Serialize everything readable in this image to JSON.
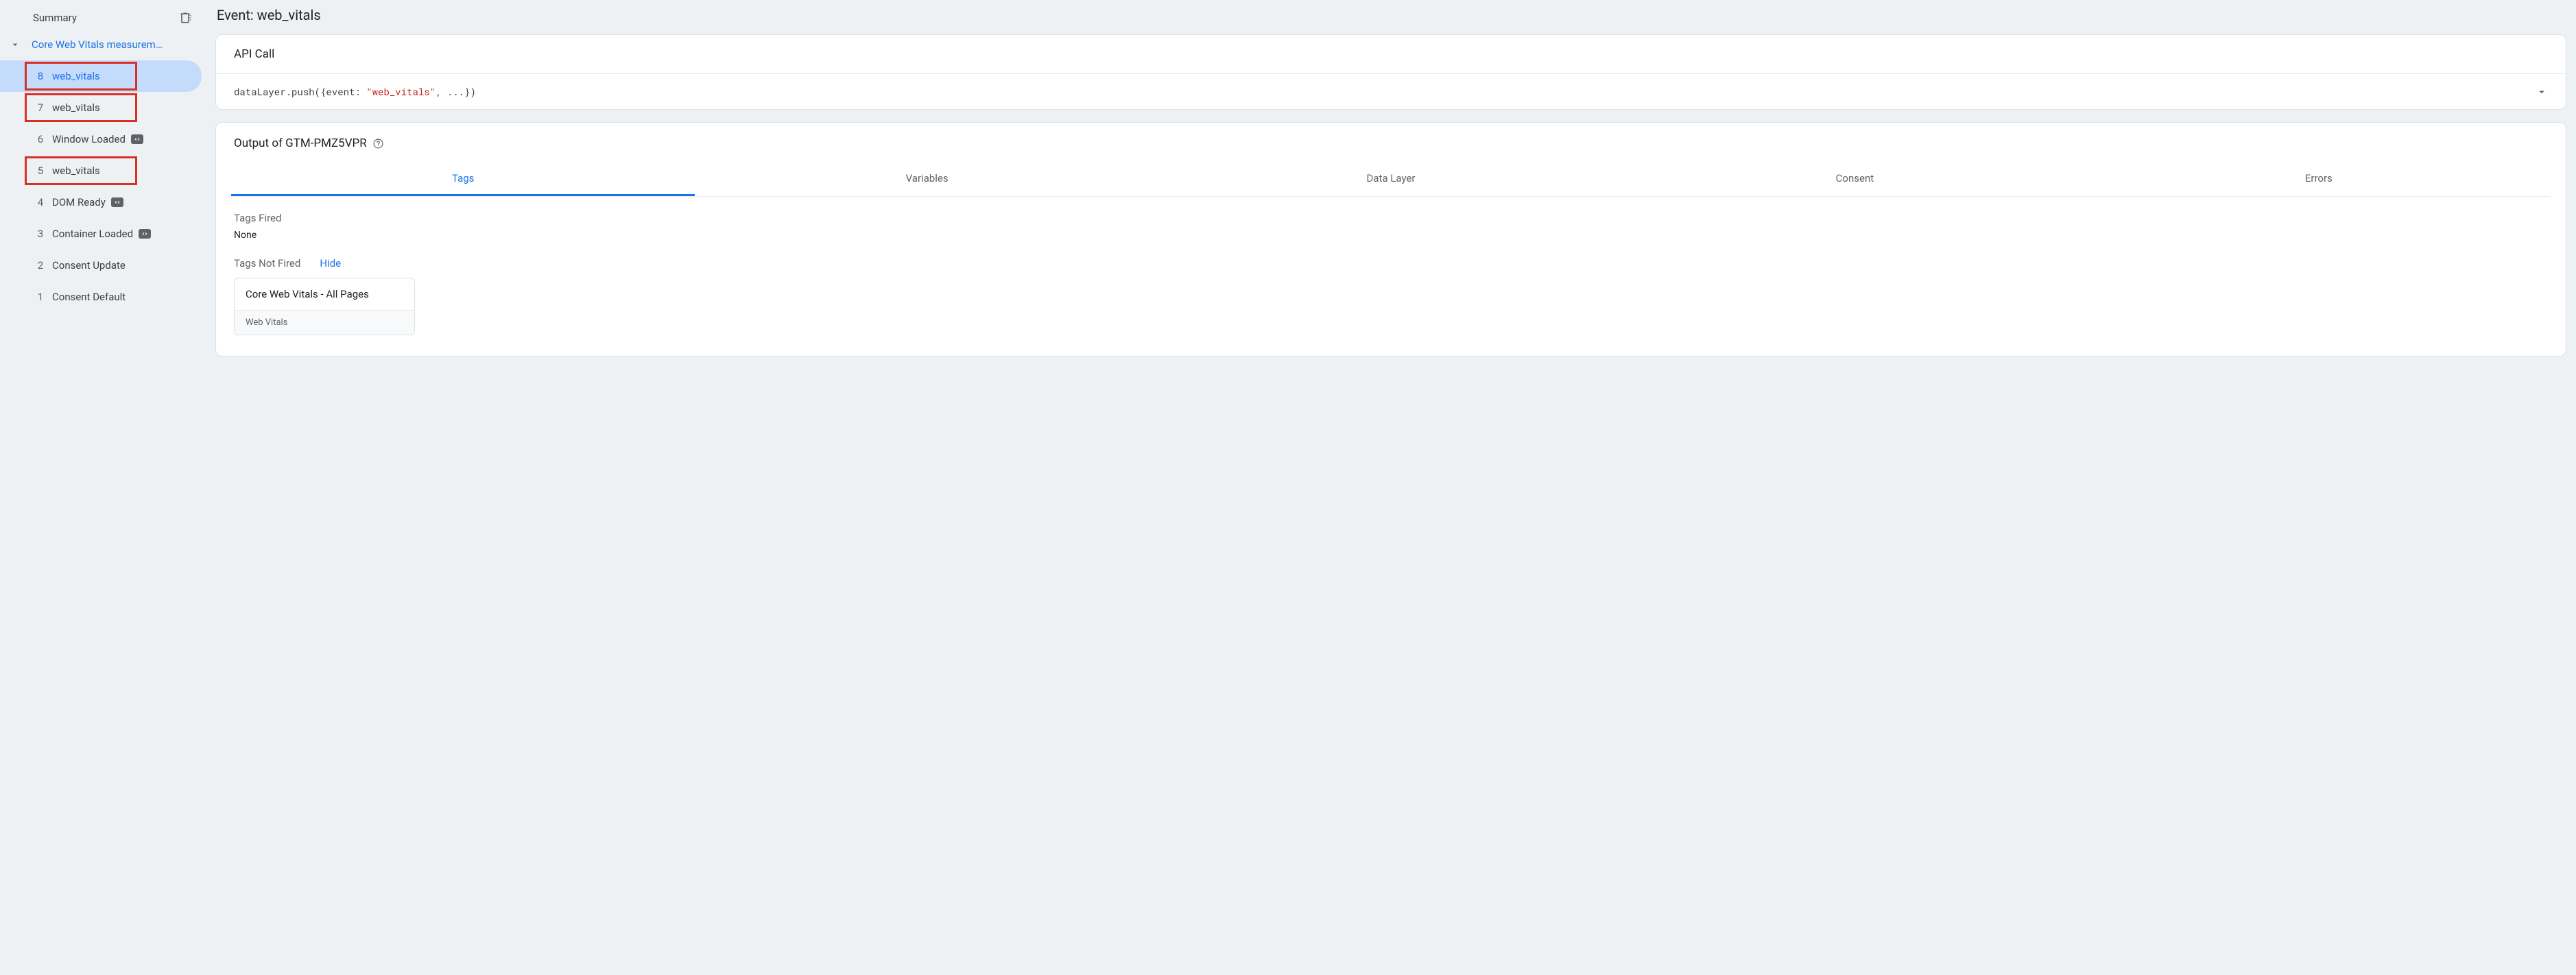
{
  "sidebar": {
    "summary_label": "Summary",
    "group_label": "Core Web Vitals measurem…",
    "events": [
      {
        "num": "8",
        "label": "web_vitals",
        "selected": true,
        "highlighted": true,
        "code": false
      },
      {
        "num": "7",
        "label": "web_vitals",
        "selected": false,
        "highlighted": true,
        "code": false
      },
      {
        "num": "6",
        "label": "Window Loaded",
        "selected": false,
        "highlighted": false,
        "code": true
      },
      {
        "num": "5",
        "label": "web_vitals",
        "selected": false,
        "highlighted": true,
        "code": false
      },
      {
        "num": "4",
        "label": "DOM Ready",
        "selected": false,
        "highlighted": false,
        "code": true
      },
      {
        "num": "3",
        "label": "Container Loaded",
        "selected": false,
        "highlighted": false,
        "code": true
      },
      {
        "num": "2",
        "label": "Consent Update",
        "selected": false,
        "highlighted": false,
        "code": false
      },
      {
        "num": "1",
        "label": "Consent Default",
        "selected": false,
        "highlighted": false,
        "code": false
      }
    ]
  },
  "main": {
    "title": "Event: web_vitals",
    "api_call": {
      "header": "API Call",
      "code_prefix": "dataLayer.push({event: ",
      "code_value": "\"web_vitals\"",
      "code_suffix": ", ...})"
    },
    "output": {
      "header": "Output of GTM-PMZ5VPR",
      "tabs": [
        "Tags",
        "Variables",
        "Data Layer",
        "Consent",
        "Errors"
      ],
      "active_tab": 0,
      "fired_label": "Tags Fired",
      "fired_none": "None",
      "not_fired_label": "Tags Not Fired",
      "hide_label": "Hide",
      "tag_not_fired": {
        "title": "Core Web Vitals - All Pages",
        "type": "Web Vitals"
      }
    }
  }
}
